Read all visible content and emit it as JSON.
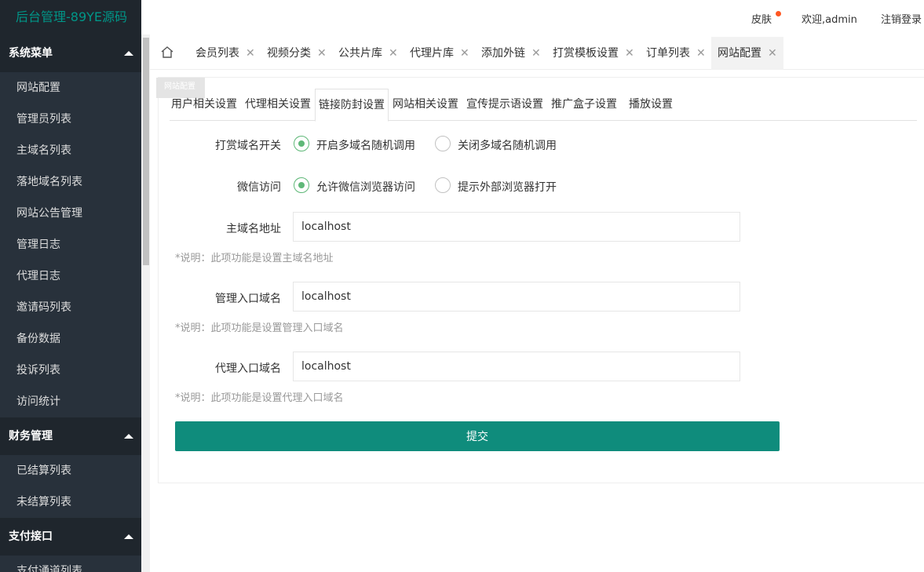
{
  "app": {
    "title": "后台管理-89YE源码"
  },
  "header": {
    "skin": "皮肤",
    "welcome": "欢迎,admin",
    "logout": "注销登录"
  },
  "sidebar": {
    "groups": [
      {
        "title": "系统菜单",
        "items": [
          "网站配置",
          "管理员列表",
          "主域名列表",
          "落地域名列表",
          "网站公告管理",
          "管理日志",
          "代理日志",
          "邀请码列表",
          "备份数据",
          "投诉列表",
          "访问统计"
        ]
      },
      {
        "title": "财务管理",
        "items": [
          "已结算列表",
          "未结算列表"
        ]
      },
      {
        "title": "支付接口",
        "items": [
          "支付通道列表"
        ]
      }
    ]
  },
  "tabs": [
    "会员列表",
    "视频分类",
    "公共片库",
    "代理片库",
    "添加外链",
    "打赏模板设置",
    "订单列表",
    "网站配置"
  ],
  "active_tab": "网站配置",
  "tooltip": "网站配置",
  "subtabs": [
    "用户相关设置",
    "代理相关设置",
    "链接防封设置",
    "网站相关设置",
    "宣传提示语设置",
    "推广盒子设置",
    "播放设置"
  ],
  "active_subtab": "链接防封设置",
  "form": {
    "reward_domain": {
      "label": "打赏域名开关",
      "option_on": "开启多域名随机调用",
      "option_off": "关闭多域名随机调用",
      "selected": "on"
    },
    "wechat": {
      "label": "微信访问",
      "option_on": "允许微信浏览器访问",
      "option_off": "提示外部浏览器打开",
      "selected": "on"
    },
    "main_domain": {
      "label": "主域名地址",
      "value": "localhost",
      "note": "*说明：此项功能是设置主域名地址"
    },
    "admin_domain": {
      "label": "管理入口域名",
      "value": "localhost",
      "note": "*说明：此项功能是设置管理入口域名"
    },
    "agent_domain": {
      "label": "代理入口域名",
      "value": "localhost",
      "note": "*说明：此项功能是设置代理入口域名"
    },
    "submit": "提交"
  },
  "colors": {
    "sidebar_bg": "#28313b",
    "accent": "#009688",
    "submit_bg": "#0f8c7c",
    "radio_on": "#5fb878",
    "notify_dot": "#ff5722"
  }
}
